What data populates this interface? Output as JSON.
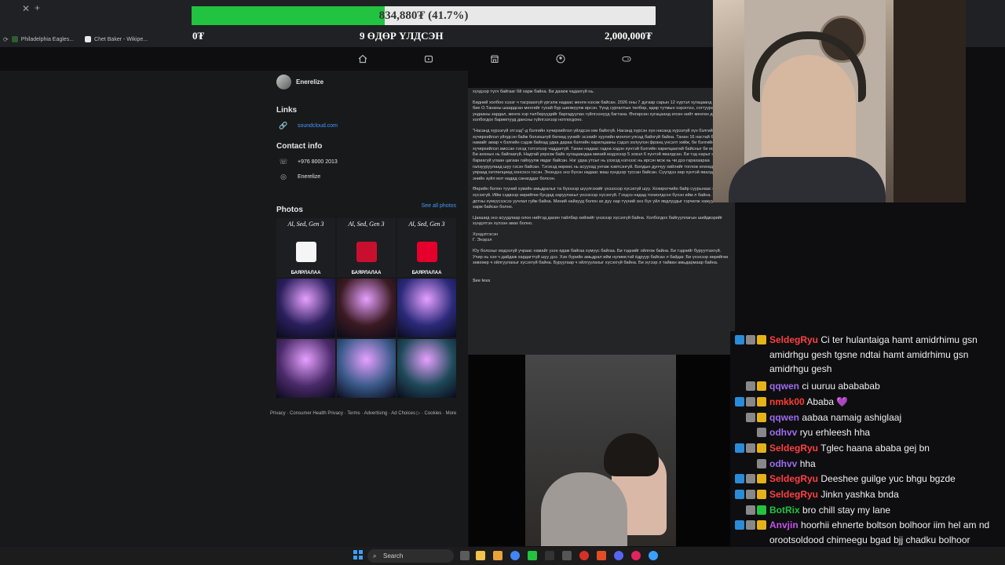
{
  "browser": {
    "bookmarks": [
      {
        "label": "Philadelphia Eagles..."
      },
      {
        "label": "Chet Baker - Wikipe..."
      }
    ]
  },
  "goal": {
    "current": "834,880₮ (41.7%)",
    "progress_fraction": 0.417,
    "min_label": "0₮",
    "days_label": "9 ӨДӨР ҮЛДСЭН",
    "max_label": "2,000,000₮",
    "fill_color": "#22c340"
  },
  "fb_nav": {
    "icons": [
      "home-icon",
      "watch-icon",
      "marketplace-icon",
      "groups-icon",
      "gaming-icon"
    ]
  },
  "profile": {
    "name": "Enerelize"
  },
  "links": {
    "title": "Links",
    "items": [
      {
        "icon": "link-icon",
        "label": "soundcloud.com"
      }
    ]
  },
  "contact": {
    "title": "Contact info",
    "items": [
      {
        "icon": "phone-icon",
        "label": "+976 8000 2013"
      },
      {
        "icon": "messenger-icon",
        "label": "Enerelize"
      }
    ]
  },
  "photos": {
    "title": "Photos",
    "see_all": "See all photos",
    "tiles": [
      {
        "top": "Al, Sed, Gen 3",
        "label": "БАЯРЛАЛАА",
        "bg": "#1d1e22",
        "logo": "#f5f5f5"
      },
      {
        "top": "Al, Sed, Gen 3",
        "label": "БАЯРЛАЛАА",
        "bg": "#1d1e22",
        "logo": "#c8102e"
      },
      {
        "top": "Al, Sed, Gen 3",
        "label": "БАЯРЛАЛАА",
        "bg": "#1d1e22",
        "logo": "#e4002b"
      },
      {
        "top": "",
        "label": "",
        "bg": "#2a1f5c",
        "logo": ""
      },
      {
        "top": "",
        "label": "",
        "bg": "#3b1a22",
        "logo": ""
      },
      {
        "top": "",
        "label": "",
        "bg": "#2a2a7a",
        "logo": ""
      },
      {
        "top": "",
        "label": "",
        "bg": "#4a2a6a",
        "logo": ""
      },
      {
        "top": "",
        "label": "",
        "bg": "#3a5a8a",
        "logo": ""
      },
      {
        "top": "",
        "label": "",
        "bg": "#1f4a5a",
        "logo": ""
      }
    ]
  },
  "footer": {
    "text": "Privacy · Consumer Health Privacy · Terms · Advertising · Ad Choices ▷ · Cookies · More"
  },
  "article": {
    "paragraphs": [
      "хүндээр түсч байгааг бй харж байна. Би дахиж чадахгүй нь.",
      "Бидний холбоо хэээг ч тасраахгүй үргэлж надаас менгө нэхэж байсан. 2026 оны 7 дугаар сарын 12 хүртэл хугацаанд миний бие О.Тананы шаардсан менгийг тухай бүр шилжүүлж ирсэн. Үүнд сургалтын төлбөр, өдөр тутмын хэрэглээ, согтуурахууд ундааны зардал, менгө хэр төлбөрүүдийг баргадуулан гүйлгээнүүд багтана. Өнгөрсөн хугацаанд өгсөн нийт менгөн дүн, холбогдох баримтууд дансны гүйлгээгээр нотлогдоно.",
      "\"Насанд хүрээгүй этгээд\"-д бэлгийн хүчирхийлэл үйлдсэн юм байхгүй. Насанд хүрсэн хүн насанд хүрээгүй хүн бэлгийн хүчирхийлэл үйлдсэн байж болзошгүй бөгөөд үүнийг эсэхийг хуулийн монгол улсад байхгүй байна. Танан 16 настай байхдаа намайг амар ч бэлгийн сэдэв байхад удаа дараа бэлгийн харилцааны сэдэл эхлүүлэн франц үнсэлт хийж, би бэлгийн хүчирхийлэл амссан гэхэд тэтгэлээр чаддаггүй. Танан надаас гадна хэдэн хүнтэй бэлгийн харилцаатай байсныг би мэдэхгүй. Би анхных нь байгаагүй. Надтай уерхэж байх хугацаандаа миний мэдэхээр 5 эсвэл 6 хүнтэй явалдсан. Би тэд нарыг нь бариагүй улаан цагаан гайхуулж явдаг байсан. Нэг удаа утсыг нь үзэхэд нэгнээс нь ирсэн мсж нь чи дээ гарахаараа галзууруулаад шуу гэсэн байсан. Тэгэхэд өөрөөс нь асуухад унтаж хэвтсэнгүй. Болдын дунчуу хийлийг тоглож өгөхөд нь уяраад хөтлөлцөөд хонсосн гэсэн. Энэндээ энэ бүхэн надаас маш хүндээр туссан байсан. Сүүлдээ өөр хүнтэй явалдаж нь энийн зүйл мэт надад санагддаг болсон.",
      "Өөрийн болон түүний хувийн амьдралыг та бүхнээр шүүлгэхийг үнээхээр хүсэхгүй шуу. Хохирогчийн байр суурьнаас ярихыг ч хүсэхгүй. Ийм сэдвээр өөрийгөө бусдад харуулахыг үнээхээр хүсэхгүй. Гэхдээ надад тохиолдсон бүхэн ийм л байна. Ойр дотны хүмүүсээсээ уучлал гуйж байна. Миний найзууд болон ах дүү нар түүний энэ бүх үйл явдлуудыг гэрчилж хажуунаас нь харж байсан болно.",
      "Цаашид энэ асуудлаар олон нийтэд дахин тайлбар хийхийг үнэхээр хүсэхгүй байна. Холбогдох байгууллагын шийдвэрийг хүндэтгэн хүлээн авах болно.",
      "Хүндэтгэсэн\nГ. Энэрэл",
      "Юу болсныг мэдээгүй учраас намайг үзэн ядаж байгаа хүмүүс байгаа. Би тэднийг ойлгож байна. Би тэднийг буруутгахгүй. Учир нь хэн ч дайдаж хардагтгүй шуу дээ. Хэн бүрийн амьдрал ийм нүлимстэй ёдруур байсан л байдаг. Би үнэхээр өөрийгөө зөвхөөр ч ойлгуулахыг хүсэхгүй байна. Буруугаар ч ойлгуулахыг хүсэхгүй байна. Би зүгээр л тайван амьдармаар байна."
    ],
    "see_less": "See less"
  },
  "chat": {
    "messages": [
      {
        "user": "SeldegRyu",
        "color": "#ff4040",
        "badges": [
          "#2a8bd8",
          "#888",
          "#e5b319"
        ],
        "text": "Ci ter hulantaiga hamt amidrhimu gsn amidrhgu gesh tgsne ndtai hamt amidrhimu gsn amidrhgu gesh",
        "lines": 3
      },
      {
        "user": "qqwen",
        "color": "#9d6cf0",
        "badges": [
          "#888",
          "#e5b319"
        ],
        "text": "ci uuruu abababab",
        "lines": 1
      },
      {
        "user": "nmkk00",
        "color": "#ff3b30",
        "badges": [
          "#2a8bd8",
          "#888",
          "#e5b319"
        ],
        "text": "Ababa 💜",
        "lines": 1
      },
      {
        "user": "qqwen",
        "color": "#9d6cf0",
        "badges": [
          "#888",
          "#e5b319"
        ],
        "text": "aabaa namaig ashiglaaj",
        "lines": 1
      },
      {
        "user": "odhvv",
        "color": "#9d6cf0",
        "badges": [
          "#888"
        ],
        "text": "ryu erhleesh hha",
        "lines": 1
      },
      {
        "user": "SeldegRyu",
        "color": "#ff4040",
        "badges": [
          "#2a8bd8",
          "#888",
          "#e5b319"
        ],
        "text": "Tglec haana ababa gej bn",
        "lines": 1
      },
      {
        "user": "odhvv",
        "color": "#9d6cf0",
        "badges": [
          "#888"
        ],
        "text": "hha",
        "lines": 1
      },
      {
        "user": "SeldegRyu",
        "color": "#ff4040",
        "badges": [
          "#2a8bd8",
          "#888",
          "#e5b319"
        ],
        "text": "Deeshee guilge yuc bhgu bgzde",
        "lines": 1
      },
      {
        "user": "SeldegRyu",
        "color": "#ff4040",
        "badges": [
          "#2a8bd8",
          "#888",
          "#e5b319"
        ],
        "text": "Jinkn yashka bnda",
        "lines": 1
      },
      {
        "user": "BotRix",
        "color": "#22c340",
        "badges": [
          "#888",
          "#22c340"
        ],
        "text": "bro chill stay my lane",
        "lines": 1
      },
      {
        "user": "Anvjin",
        "color": "#c353e8",
        "badges": [
          "#2a8bd8",
          "#888",
          "#e5b319"
        ],
        "text": "hoorhii ehnerte boltson bolhoor iim hel am nd orootsoldood chimeegu bgad bjj chadku bolhoor bichssim shig bn lee",
        "lines": 3
      }
    ]
  },
  "taskbar": {
    "search_label": "Search"
  }
}
